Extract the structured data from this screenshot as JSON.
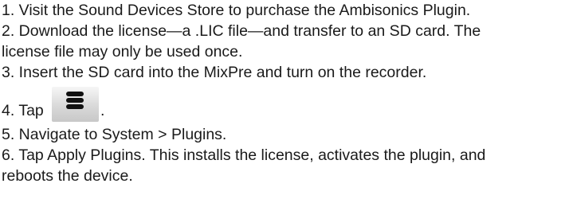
{
  "steps": [
    "1. Visit the Sound Devices Store to purchase the Ambisonics Plugin.",
    "2. Download the license—a .LIC file—and transfer to an SD card. The",
    "license file may only be used once.",
    "3. Insert the SD card into the MixPre and turn on the recorder.",
    "4. Tap",
    ".",
    "5. Navigate to System > Plugins.",
    "6. Tap Apply Plugins. This installs the license, activates the plugin, and",
    "reboots the device."
  ],
  "icons": {
    "menu": "hamburger-menu-icon"
  }
}
